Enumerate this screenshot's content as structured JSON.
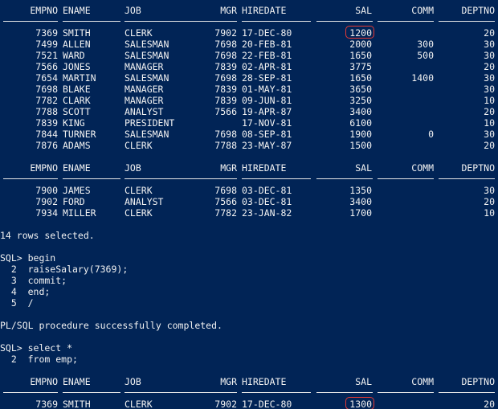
{
  "terminal": {
    "headers": {
      "empno": "EMPNO",
      "ename": "ENAME",
      "job": "JOB",
      "mgr": "MGR",
      "hiredate": "HIREDATE",
      "sal": "SAL",
      "comm": "COMM",
      "deptno": "DEPTNO"
    },
    "block1_rows": [
      {
        "empno": "7369",
        "ename": "SMITH",
        "job": "CLERK",
        "mgr": "7902",
        "hiredate": "17-DEC-80",
        "sal": "1200",
        "comm": "",
        "deptno": "20"
      },
      {
        "empno": "7499",
        "ename": "ALLEN",
        "job": "SALESMAN",
        "mgr": "7698",
        "hiredate": "20-FEB-81",
        "sal": "2000",
        "comm": "300",
        "deptno": "30"
      },
      {
        "empno": "7521",
        "ename": "WARD",
        "job": "SALESMAN",
        "mgr": "7698",
        "hiredate": "22-FEB-81",
        "sal": "1650",
        "comm": "500",
        "deptno": "30"
      },
      {
        "empno": "7566",
        "ename": "JONES",
        "job": "MANAGER",
        "mgr": "7839",
        "hiredate": "02-APR-81",
        "sal": "3775",
        "comm": "",
        "deptno": "20"
      },
      {
        "empno": "7654",
        "ename": "MARTIN",
        "job": "SALESMAN",
        "mgr": "7698",
        "hiredate": "28-SEP-81",
        "sal": "1650",
        "comm": "1400",
        "deptno": "30"
      },
      {
        "empno": "7698",
        "ename": "BLAKE",
        "job": "MANAGER",
        "mgr": "7839",
        "hiredate": "01-MAY-81",
        "sal": "3650",
        "comm": "",
        "deptno": "30"
      },
      {
        "empno": "7782",
        "ename": "CLARK",
        "job": "MANAGER",
        "mgr": "7839",
        "hiredate": "09-JUN-81",
        "sal": "3250",
        "comm": "",
        "deptno": "10"
      },
      {
        "empno": "7788",
        "ename": "SCOTT",
        "job": "ANALYST",
        "mgr": "7566",
        "hiredate": "19-APR-87",
        "sal": "3400",
        "comm": "",
        "deptno": "20"
      },
      {
        "empno": "7839",
        "ename": "KING",
        "job": "PRESIDENT",
        "mgr": "",
        "hiredate": "17-NOV-81",
        "sal": "6100",
        "comm": "",
        "deptno": "10"
      },
      {
        "empno": "7844",
        "ename": "TURNER",
        "job": "SALESMAN",
        "mgr": "7698",
        "hiredate": "08-SEP-81",
        "sal": "1900",
        "comm": "0",
        "deptno": "30"
      },
      {
        "empno": "7876",
        "ename": "ADAMS",
        "job": "CLERK",
        "mgr": "7788",
        "hiredate": "23-MAY-87",
        "sal": "1500",
        "comm": "",
        "deptno": "20"
      }
    ],
    "block2_rows": [
      {
        "empno": "7900",
        "ename": "JAMES",
        "job": "CLERK",
        "mgr": "7698",
        "hiredate": "03-DEC-81",
        "sal": "1350",
        "comm": "",
        "deptno": "30"
      },
      {
        "empno": "7902",
        "ename": "FORD",
        "job": "ANALYST",
        "mgr": "7566",
        "hiredate": "03-DEC-81",
        "sal": "3400",
        "comm": "",
        "deptno": "20"
      },
      {
        "empno": "7934",
        "ename": "MILLER",
        "job": "CLERK",
        "mgr": "7782",
        "hiredate": "23-JAN-82",
        "sal": "1700",
        "comm": "",
        "deptno": "10"
      }
    ],
    "rows_selected": "14 rows selected.",
    "plsql_lines": [
      "SQL> begin",
      "  2  raiseSalary(7369);",
      "  3  commit;",
      "  4  end;",
      "  5  /"
    ],
    "plsql_result": "PL/SQL procedure successfully completed.",
    "query_lines": [
      "SQL> select *",
      "  2  from emp;"
    ],
    "block3_rows": [
      {
        "empno": "7369",
        "ename": "SMITH",
        "job": "CLERK",
        "mgr": "7902",
        "hiredate": "17-DEC-80",
        "sal": "1300",
        "comm": "",
        "deptno": "20"
      }
    ],
    "highlight_color": "#e53935",
    "background_color": "#012456",
    "text_color": "#f2f2f2"
  }
}
